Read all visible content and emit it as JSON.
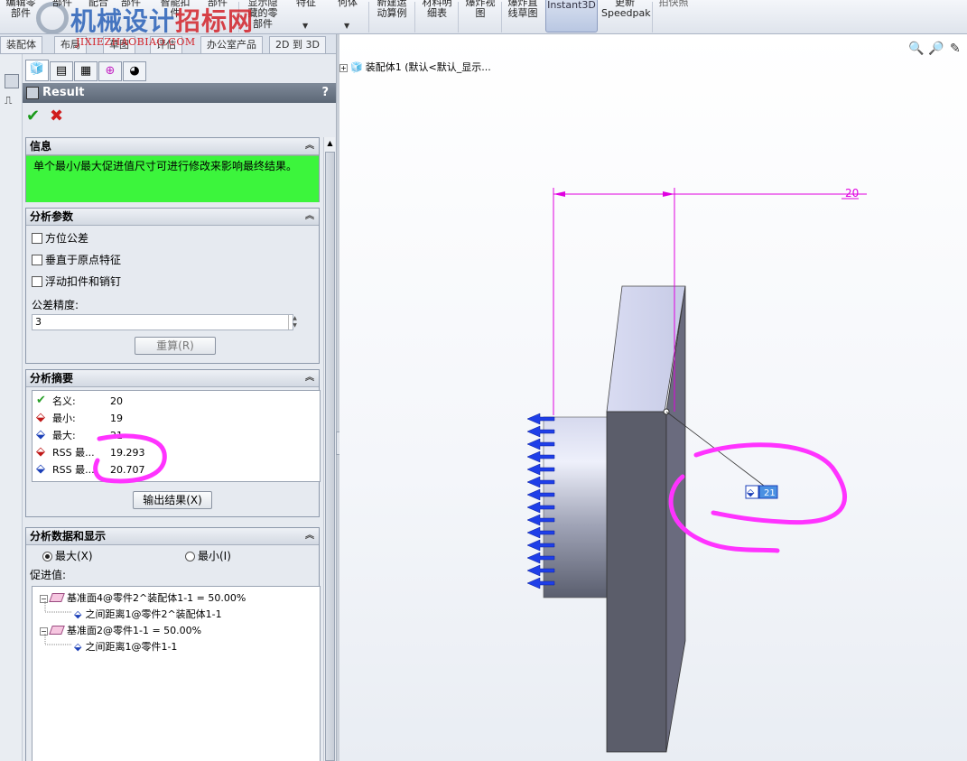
{
  "ribbon": {
    "buttons": [
      {
        "label": "编辑零\n部件"
      },
      {
        "label": "部件"
      },
      {
        "label": "配合"
      },
      {
        "label": "部件"
      },
      {
        "label": "智能扣\n件"
      },
      {
        "label": "部件"
      },
      {
        "label": "显示隐\n藏的零\n部件"
      },
      {
        "label": "特征"
      },
      {
        "label": "何体"
      },
      {
        "label": "新建运\n动算例"
      },
      {
        "label": "材料明\n细表"
      },
      {
        "label": "爆炸视\n图"
      },
      {
        "label": "爆炸直\n线草图"
      },
      {
        "label": "Instant3D"
      },
      {
        "label": "更新\nSpeedpak"
      },
      {
        "label": "拍快照"
      }
    ]
  },
  "watermark": {
    "main": "机械设计",
    "accent": "招标网",
    "sub": "JIXIEZHAOBIAO.COM"
  },
  "tabs": [
    "装配体",
    "布局",
    "草图",
    "评估",
    "办公室产品",
    "2D 到 3D"
  ],
  "property_manager": {
    "title": "Result",
    "help": "?",
    "info": {
      "header": "信息",
      "message": "单个最小/最大促进值尺寸可进行修改来影响最终结果。"
    },
    "params": {
      "header": "分析参数",
      "options": [
        "方位公差",
        "垂直于原点特征",
        "浮动扣件和销钉"
      ],
      "tolerance_label": "公差精度:",
      "tolerance_value": "3",
      "recalc_label": "重算(R)"
    },
    "summary": {
      "header": "分析摘要",
      "rows": [
        {
          "label": "名义:",
          "value": "20"
        },
        {
          "label": "最小:",
          "value": "19"
        },
        {
          "label": "最大:",
          "value": "21"
        },
        {
          "label": "RSS 最...",
          "value": "19.293"
        },
        {
          "label": "RSS 最...",
          "value": "20.707"
        }
      ],
      "export_label": "输出结果(X)"
    },
    "display": {
      "header": "分析数据和显示",
      "radio_max": "最大(X)",
      "radio_min": "最小(I)",
      "contrib_label": "促进值:",
      "tree": [
        {
          "text": "基准面4@零件2^装配体1-1 = 50.00%"
        },
        {
          "text": "之间距离1@零件2^装配体1-1"
        },
        {
          "text": "基准面2@零件1-1 = 50.00%"
        },
        {
          "text": "之间距离1@零件1-1"
        }
      ]
    }
  },
  "viewport": {
    "tree_item": "装配体1  (默认<默认_显示...",
    "dimension_value": "20",
    "result_value": "21"
  },
  "colors": {
    "info_bg": "#3cf53c",
    "annotation": "#ff33ff",
    "dimension": "#e000e0",
    "arrows": "#1f3fe8"
  }
}
